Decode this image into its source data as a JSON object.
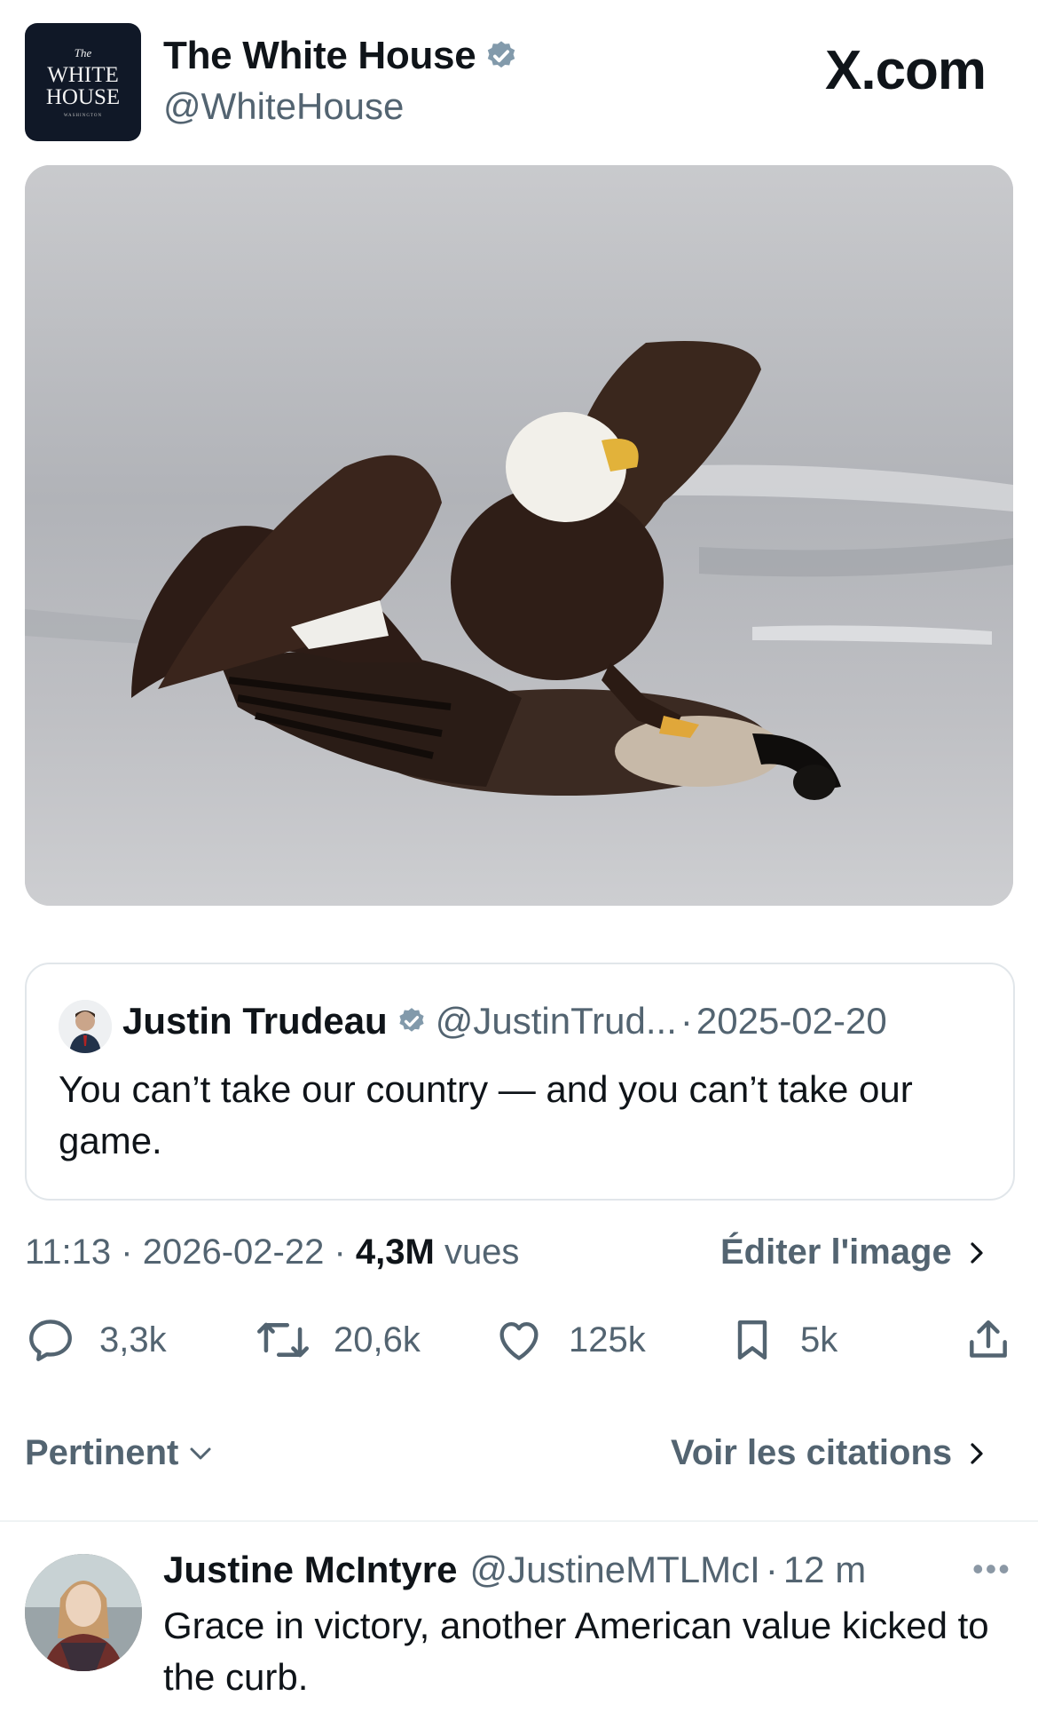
{
  "header": {
    "avatar_text": {
      "line1": "The",
      "line2": "WHITE",
      "line3": "HOUSE",
      "line4": "WASHINGTON"
    },
    "author_name": "The White House",
    "author_handle": "@WhiteHouse",
    "brand": "X.com"
  },
  "quoted_post": {
    "author_name": "Justin Trudeau",
    "author_handle": "@JustinTrud...",
    "separator": "·",
    "date": "2025-02-20",
    "text": "You can’t take our country — and you can’t take our game."
  },
  "meta": {
    "time": "11:13",
    "date": "2026-02-22",
    "views_count": "4,3M",
    "views_label": "vues",
    "edit_image": "Éditer l'image"
  },
  "actions": {
    "replies": "3,3k",
    "reposts": "20,6k",
    "likes": "125k",
    "bookmarks": "5k"
  },
  "sort": {
    "label": "Pertinent",
    "quotes_link": "Voir les citations"
  },
  "reply": {
    "author_name": "Justine McIntyre",
    "author_handle": "@JustineMTLMcI",
    "time": "12 m",
    "text": "Grace in victory, another American value kicked to the curb."
  },
  "colors": {
    "text_primary": "#0f1419",
    "text_secondary": "#536471",
    "verified_badge": "#829aab",
    "avatar_bg": "#101827"
  },
  "icons": [
    "verified-badge-icon",
    "reply-icon",
    "repost-icon",
    "like-icon",
    "bookmark-icon",
    "share-icon",
    "chevron-right-icon",
    "chevron-down-icon",
    "more-icon"
  ]
}
